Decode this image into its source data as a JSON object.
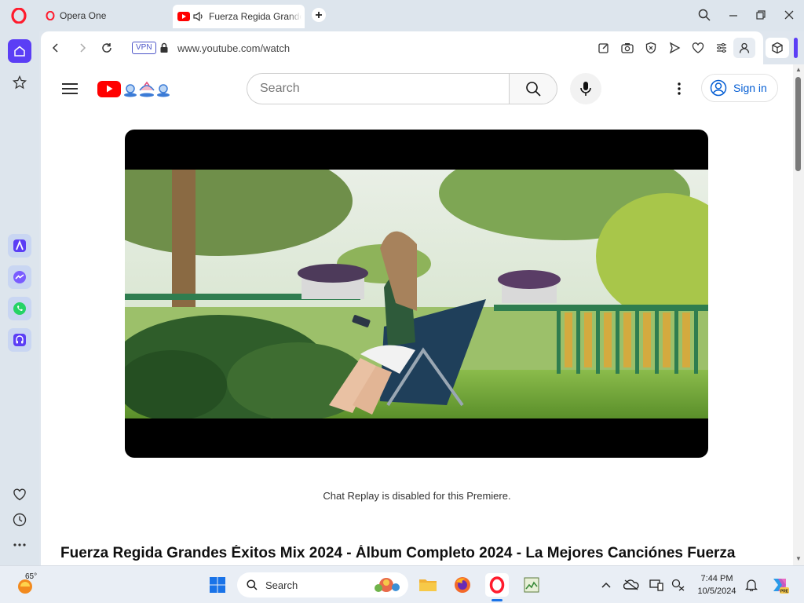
{
  "browser": {
    "tabs": [
      {
        "title": "Opera One"
      },
      {
        "title": "Fuerza Regida Grandes Éxitos Mix 2024"
      }
    ],
    "address": {
      "vpn_label": "VPN",
      "url": "www.youtube.com/watch"
    }
  },
  "youtube": {
    "search_placeholder": "Search",
    "signin_label": "Sign in",
    "chat_note": "Chat Replay is disabled for this Premiere.",
    "video_title": "Fuerza Regida Grandes Éxitos Mix 2024 - Álbum Completo 2024 - La Mejores Canciónes Fuerza"
  },
  "taskbar": {
    "weather_temp": "65°",
    "search_label": "Search",
    "time": "7:44 PM",
    "date": "10/5/2024"
  },
  "colors": {
    "accent": "#5b3ef5",
    "youtube_red": "#ff0000",
    "link_blue": "#065fd4"
  }
}
